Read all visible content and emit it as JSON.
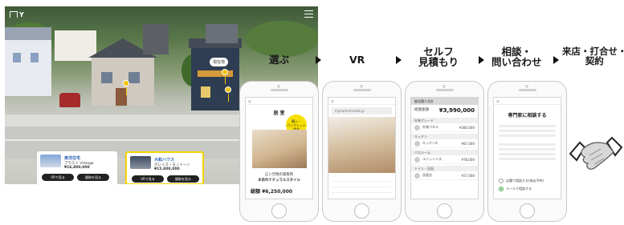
{
  "town": {
    "brand": "Y",
    "location_label": "現在地",
    "cards": [
      {
        "maker": "東洋住宅",
        "model": "プラスト Vintage",
        "price": "¥16,800,000",
        "btn_vr": "VRで見る",
        "btn_detail": "間取を見る"
      },
      {
        "maker": "大和ハウス",
        "model": "グレイス・モノトーン",
        "price": "¥15,800,000",
        "btn_vr": "VRで見る",
        "btn_detail": "間取を見る"
      }
    ]
  },
  "steps": [
    {
      "label": "選ぶ"
    },
    {
      "label": "VR"
    },
    {
      "label_line1": "セルフ",
      "label_line2": "見積もり"
    },
    {
      "label_line1": "相談・",
      "label_line2": "問い合わせ"
    },
    {
      "label_line1": "来店・打合せ・",
      "label_line2": "契約"
    }
  ],
  "phones": {
    "p1": {
      "title": "居 室",
      "badge": "購入・\nパンフレット\n請求",
      "text": "広い空間の施策例",
      "subtext": "木目のナチュラルスタイル",
      "price": "総額 ¥6,250,000"
    },
    "p2": {
      "url": "myhomemarket.jp"
    },
    "p3": {
      "header": "御見積り合計",
      "total_label": "総額金額",
      "total": "¥3,990,000",
      "sections": [
        "外装グレード",
        "キッチン",
        "バスルーム",
        "トイレ・洗面"
      ],
      "items": [
        {
          "name": "外装パネル",
          "price": "¥380,000"
        },
        {
          "name": "キッチンA",
          "price": "¥87,000"
        },
        {
          "name": "ユニットバス",
          "price": "¥78,000"
        },
        {
          "name": "洗面台",
          "price": "¥27,000"
        }
      ]
    },
    "p4": {
      "title": "専門家に相談する",
      "option1": "店舗で相談する(来店予約)",
      "option2": "メールで相談する"
    }
  }
}
